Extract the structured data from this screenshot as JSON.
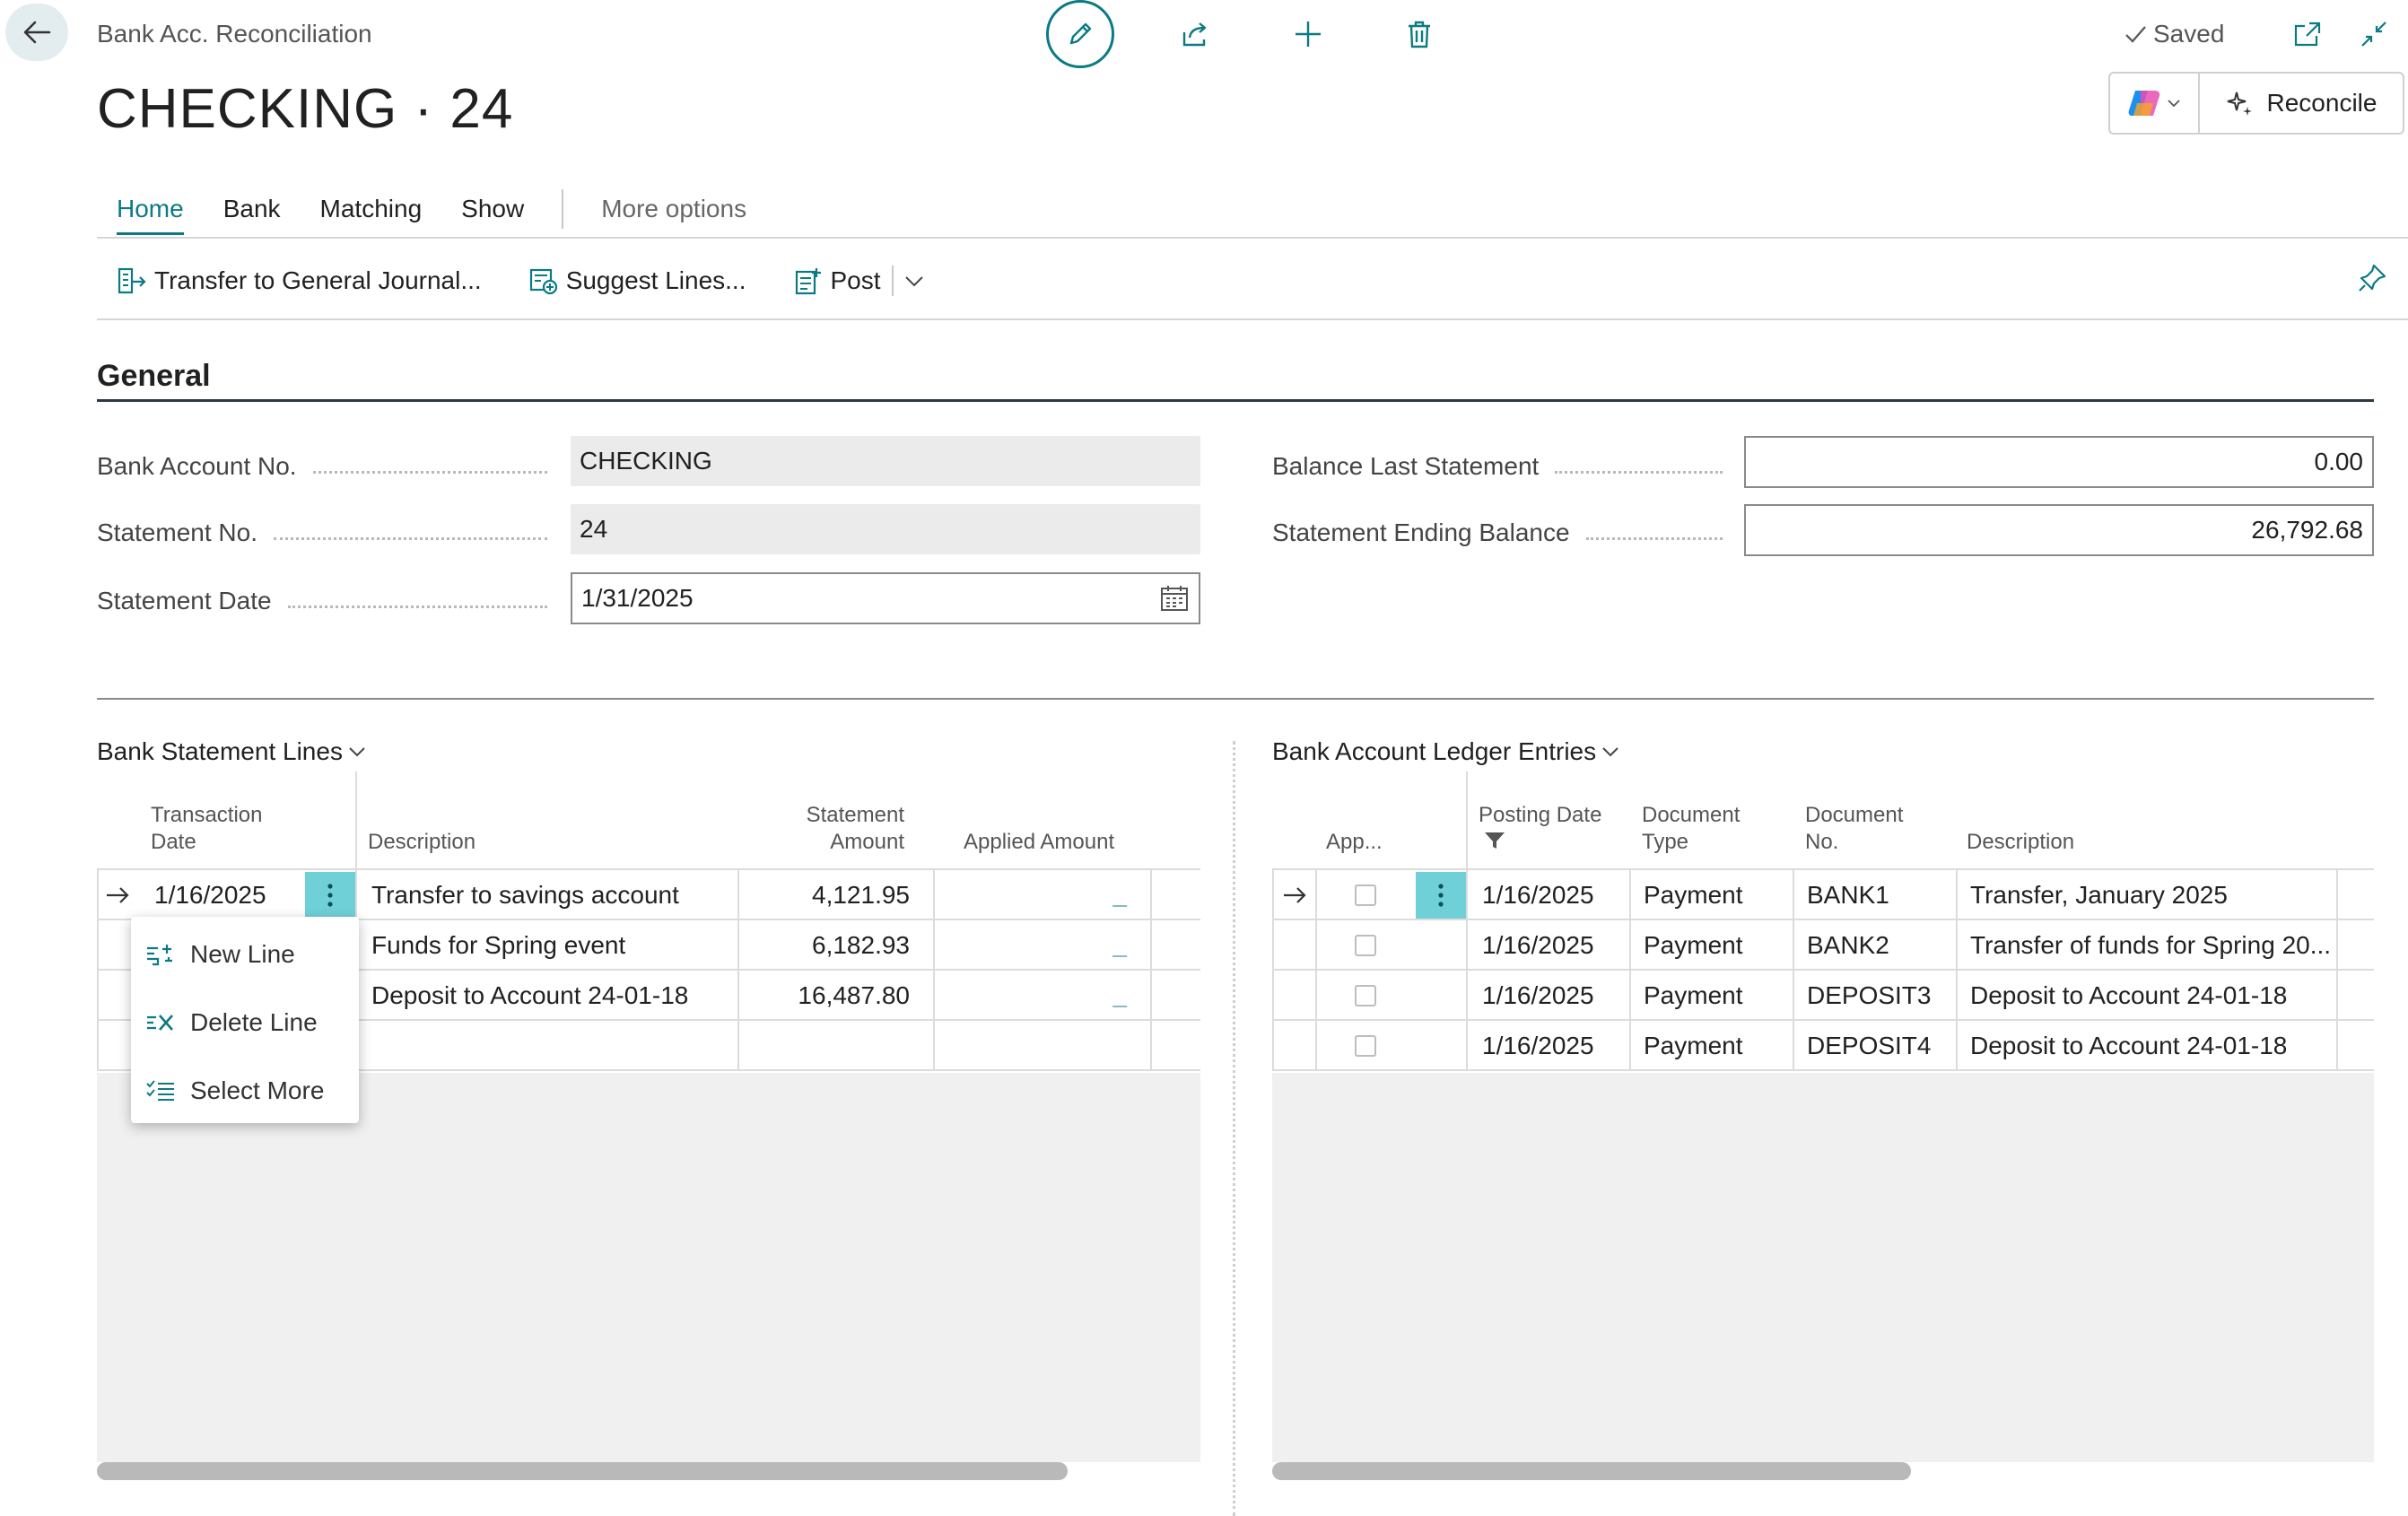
{
  "header": {
    "breadcrumb": "Bank Acc. Reconciliation",
    "title": "CHECKING · 24",
    "saved_label": "Saved",
    "reconcile_label": "Reconcile"
  },
  "tabs": [
    {
      "label": "Home",
      "active": true
    },
    {
      "label": "Bank"
    },
    {
      "label": "Matching"
    },
    {
      "label": "Show"
    },
    {
      "label": "More options"
    }
  ],
  "actions": {
    "transfer": "Transfer to General Journal...",
    "suggest": "Suggest Lines...",
    "post": "Post"
  },
  "general": {
    "section_title": "General",
    "bank_account_no_label": "Bank Account No.",
    "bank_account_no": "CHECKING",
    "statement_no_label": "Statement No.",
    "statement_no": "24",
    "statement_date_label": "Statement Date",
    "statement_date": "1/31/2025",
    "balance_last_label": "Balance Last Statement",
    "balance_last": "0.00",
    "ending_balance_label": "Statement Ending Balance",
    "ending_balance": "26,792.68"
  },
  "statement_lines": {
    "title": "Bank Statement Lines",
    "headers": {
      "date_1": "Transaction",
      "date_2": "Date",
      "description": "Description",
      "amount_1": "Statement",
      "amount_2": "Amount",
      "applied": "Applied Amount"
    },
    "rows": [
      {
        "date": "1/16/2025",
        "description": "Transfer to savings account",
        "amount": "4,121.95",
        "applied": "_"
      },
      {
        "date": "",
        "description": "Funds for Spring event",
        "amount": "6,182.93",
        "applied": "_"
      },
      {
        "date": "",
        "description": "Deposit to Account 24-01-18",
        "amount": "16,487.80",
        "applied": "_"
      }
    ],
    "context_menu": {
      "new_line": "New Line",
      "delete_line": "Delete Line",
      "select_more": "Select More"
    }
  },
  "ledger_entries": {
    "title": "Bank Account Ledger Entries",
    "headers": {
      "applied": "App...",
      "posting_date": "Posting Date",
      "doc_type_1": "Document",
      "doc_type_2": "Type",
      "doc_no_1": "Document",
      "doc_no_2": "No.",
      "description": "Description"
    },
    "rows": [
      {
        "date": "1/16/2025",
        "type": "Payment",
        "doc_no": "BANK1",
        "description": "Transfer, January 2025"
      },
      {
        "date": "1/16/2025",
        "type": "Payment",
        "doc_no": "BANK2",
        "description": "Transfer of funds for Spring 20..."
      },
      {
        "date": "1/16/2025",
        "type": "Payment",
        "doc_no": "DEPOSIT3",
        "description": "Deposit to Account 24-01-18"
      },
      {
        "date": "1/16/2025",
        "type": "Payment",
        "doc_no": "DEPOSIT4",
        "description": "Deposit to Account 24-01-18"
      }
    ]
  },
  "colors": {
    "accent": "#0b7a83",
    "selected_cell": "#6fd0d8"
  }
}
